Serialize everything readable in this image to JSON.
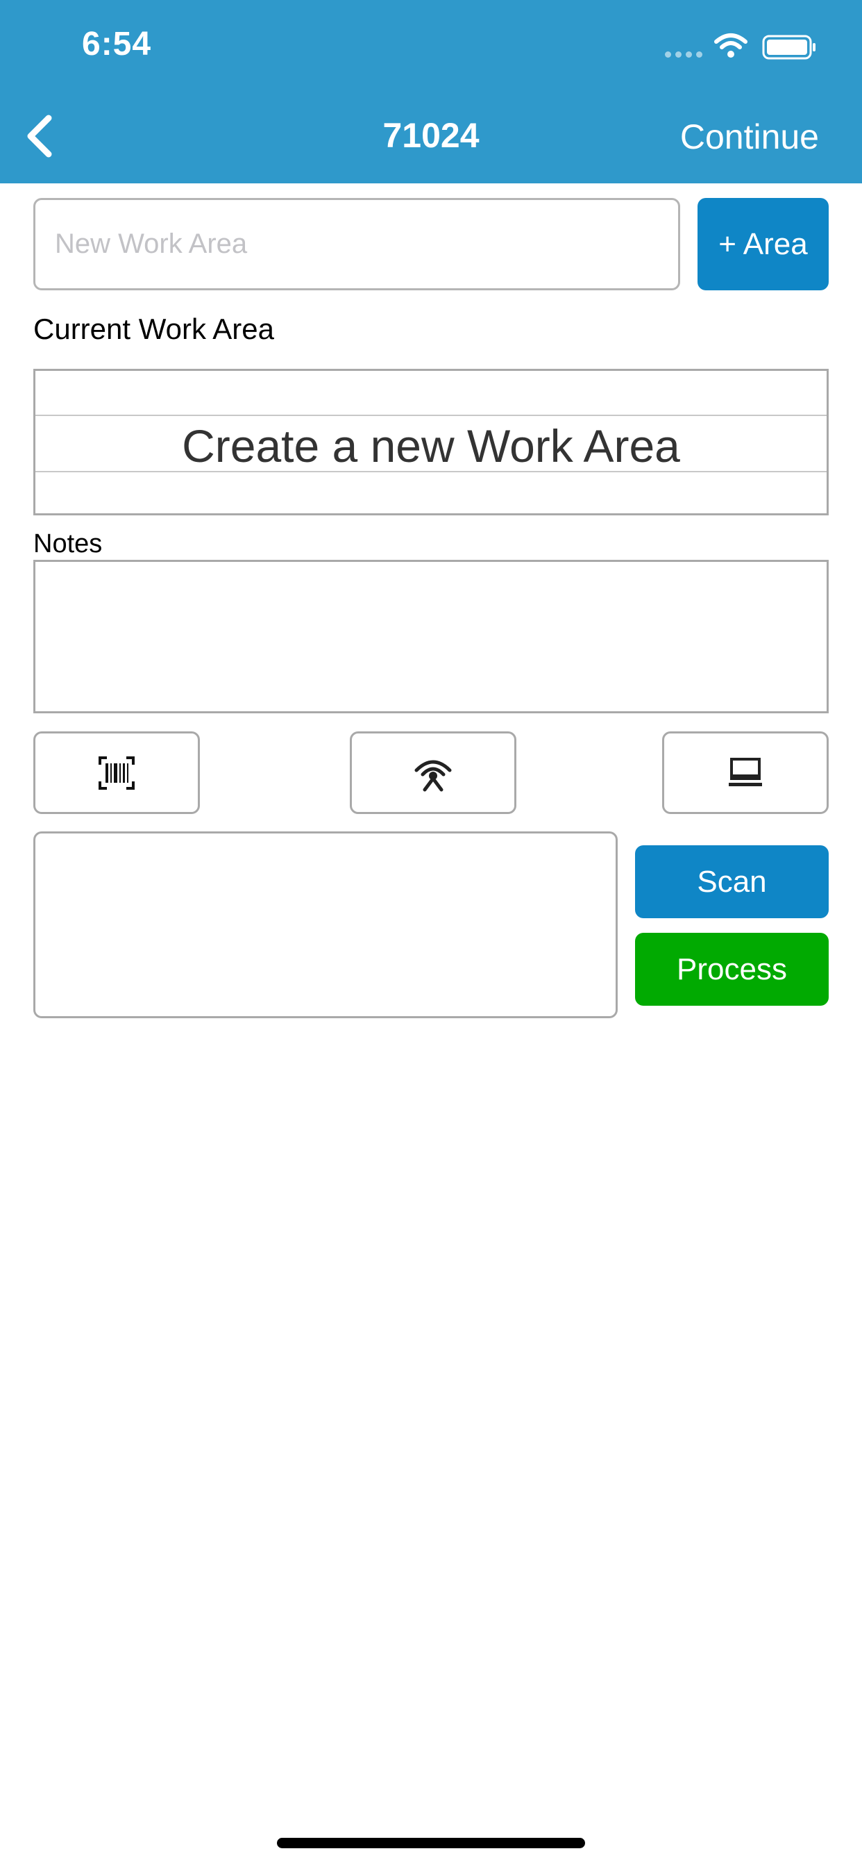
{
  "status_bar": {
    "time": "6:54",
    "icons": [
      "signal-dots-icon",
      "wifi-icon",
      "battery-icon"
    ]
  },
  "nav": {
    "back_icon": "chevron-left-icon",
    "title": "71024",
    "continue_label": "Continue"
  },
  "work_area": {
    "input_placeholder": "New Work Area",
    "input_value": "",
    "add_button_label": "+ Area",
    "current_label": "Current Work Area",
    "picker_selected": "Create a new Work Area"
  },
  "notes": {
    "label": "Notes",
    "value": ""
  },
  "mode_buttons": [
    {
      "icon": "barcode-scan-icon"
    },
    {
      "icon": "rfid-antenna-icon"
    },
    {
      "icon": "laptop-icon"
    }
  ],
  "scan": {
    "result_value": "",
    "scan_label": "Scan",
    "process_label": "Process"
  },
  "colors": {
    "header": "#2f99cb",
    "primary_button": "#0f86c6",
    "process_button": "#01aa01"
  }
}
